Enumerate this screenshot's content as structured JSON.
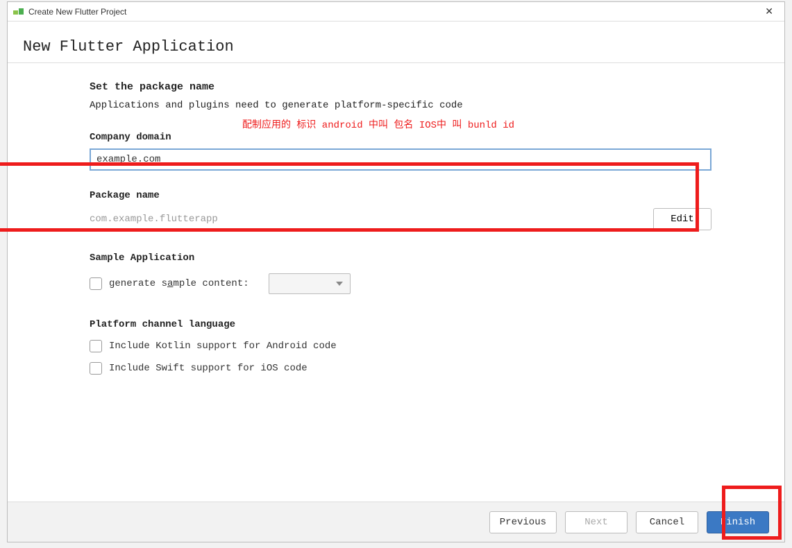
{
  "titlebar": {
    "title": "Create New Flutter Project",
    "close_symbol": "✕"
  },
  "header": {
    "title": "New Flutter Application"
  },
  "section": {
    "title": "Set the package name",
    "desc": "Applications and plugins need to generate platform-specific code"
  },
  "company_domain": {
    "label": "Company domain",
    "value": "example.com"
  },
  "annotation": {
    "text": "配制应用的 标识  android 中叫 包名 IOS中 叫 bunld id"
  },
  "package": {
    "label": "Package name",
    "value": "com.example.flutterapp",
    "edit_label": "Edit"
  },
  "sample": {
    "label": "Sample Application",
    "checkbox_prefix": "generate s",
    "checkbox_underline": "a",
    "checkbox_suffix": "mple content:"
  },
  "platform": {
    "label": "Platform channel language",
    "kotlin": "Include Kotlin support for Android code",
    "swift": "Include Swift support for iOS code"
  },
  "footer": {
    "previous": "Previous",
    "next": "Next",
    "cancel": "Cancel",
    "finish": "Finish"
  }
}
